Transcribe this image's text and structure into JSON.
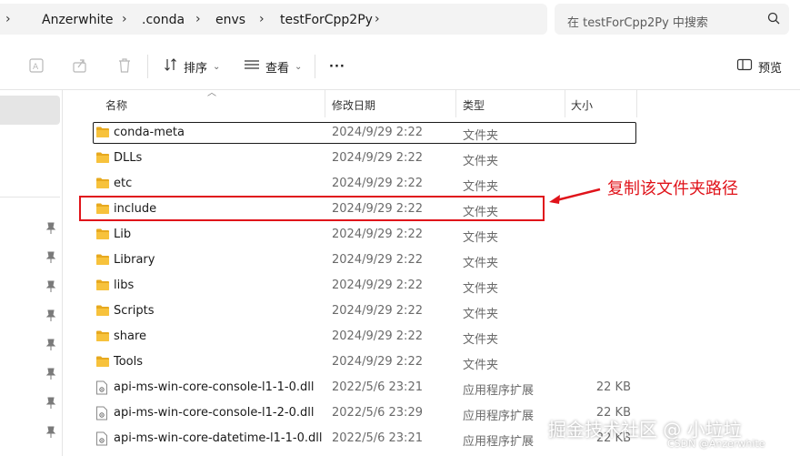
{
  "breadcrumb": {
    "items": [
      "Anzerwhite",
      ".conda",
      "envs",
      "testForCpp2Py"
    ],
    "separator": "›"
  },
  "search": {
    "placeholder": "在 testForCpp2Py 中搜索"
  },
  "toolbar": {
    "sort_label": "排序",
    "view_label": "查看",
    "more_label": "···",
    "preview_label": "预览"
  },
  "columns": {
    "name": "名称",
    "date": "修改日期",
    "type": "类型",
    "size": "大小"
  },
  "files": [
    {
      "name": "conda-meta",
      "date": "2024/9/29 2:22",
      "type": "文件夹",
      "size": "",
      "icon": "folder-icon"
    },
    {
      "name": "DLLs",
      "date": "2024/9/29 2:22",
      "type": "文件夹",
      "size": "",
      "icon": "folder-icon"
    },
    {
      "name": "etc",
      "date": "2024/9/29 2:22",
      "type": "文件夹",
      "size": "",
      "icon": "folder-icon"
    },
    {
      "name": "include",
      "date": "2024/9/29 2:22",
      "type": "文件夹",
      "size": "",
      "icon": "folder-icon"
    },
    {
      "name": "Lib",
      "date": "2024/9/29 2:22",
      "type": "文件夹",
      "size": "",
      "icon": "folder-icon"
    },
    {
      "name": "Library",
      "date": "2024/9/29 2:22",
      "type": "文件夹",
      "size": "",
      "icon": "folder-icon"
    },
    {
      "name": "libs",
      "date": "2024/9/29 2:22",
      "type": "文件夹",
      "size": "",
      "icon": "folder-icon"
    },
    {
      "name": "Scripts",
      "date": "2024/9/29 2:22",
      "type": "文件夹",
      "size": "",
      "icon": "folder-icon"
    },
    {
      "name": "share",
      "date": "2024/9/29 2:22",
      "type": "文件夹",
      "size": "",
      "icon": "folder-icon"
    },
    {
      "name": "Tools",
      "date": "2024/9/29 2:22",
      "type": "文件夹",
      "size": "",
      "icon": "folder-icon"
    },
    {
      "name": "api-ms-win-core-console-l1-1-0.dll",
      "date": "2022/5/6 23:21",
      "type": "应用程序扩展",
      "size": "22 KB",
      "icon": "dll-file-icon"
    },
    {
      "name": "api-ms-win-core-console-l1-2-0.dll",
      "date": "2022/5/6 23:29",
      "type": "应用程序扩展",
      "size": "22 KB",
      "icon": "dll-file-icon"
    },
    {
      "name": "api-ms-win-core-datetime-l1-1-0.dll",
      "date": "2022/5/6 23:21",
      "type": "应用程序扩展",
      "size": "22 KB",
      "icon": "dll-file-icon"
    }
  ],
  "annotation": {
    "text": "复制该文件夹路径",
    "color": "#e0131a"
  },
  "watermark": {
    "main": "掘金技术社区 @ 小垃垃",
    "sub": "CSDN @Anzerwhite"
  },
  "colors": {
    "folder": "#f7c23c",
    "folder_dark": "#e7a91f",
    "accent": "#e0131a"
  }
}
